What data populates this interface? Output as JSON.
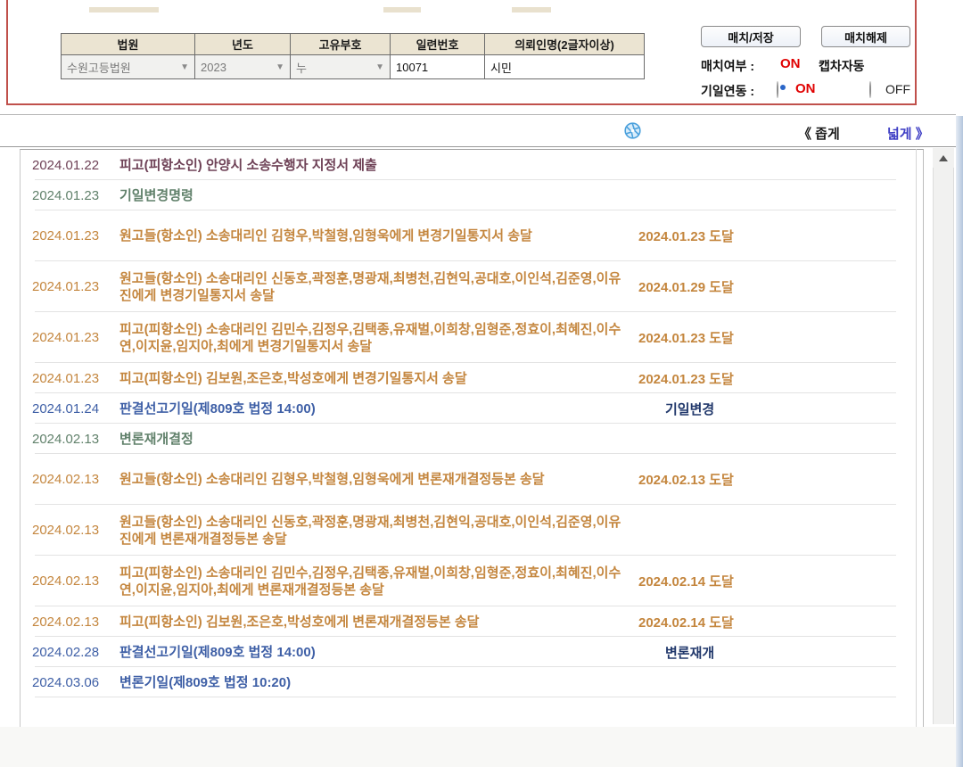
{
  "form": {
    "headers": {
      "court": "법원",
      "year": "년도",
      "code": "고유부호",
      "serial": "일련번호",
      "client": "의뢰인명(2글자이상)"
    },
    "values": {
      "court": "수원고등법원",
      "year": "2023",
      "code": "누",
      "serial": "10071",
      "client": "시민"
    }
  },
  "controls": {
    "match_save_button": "매치/저장",
    "match_clear_button": "매치해제",
    "match_status_label": "매치여부 :",
    "match_status_value": "ON",
    "captcha_auto_label": "캡차자동",
    "schedule_sync_label": "기일연동 :",
    "radio_on_label": "ON",
    "radio_off_label": "OFF"
  },
  "toolbar": {
    "narrow_label": "《 좁게",
    "wide_label": "넓게 》"
  },
  "colors": {
    "panel_border_red": "#c0504b",
    "status_red": "#e00000",
    "wide_link_blue": "#3c3cc4",
    "row_maroon": "#6e4156",
    "row_green": "#61816b",
    "row_orange": "#c4863e",
    "row_blue": "#3e5fa6",
    "status_navy": "#21386b",
    "header_beige": "#ebe4d2"
  },
  "table": {
    "rows": [
      {
        "date": "2024.01.22",
        "text": "피고(피항소인) 안양시 소송수행자 지정서 제출",
        "type": "maroon",
        "lines": 1,
        "right": "",
        "right_style": "none"
      },
      {
        "date": "2024.01.23",
        "text": "기일변경명령",
        "type": "green",
        "lines": 1,
        "right": "",
        "right_style": "none"
      },
      {
        "date": "2024.01.23",
        "text": "원고들(항소인) 소송대리인 김형우,박철형,임형욱에게 변경기일통지서 송달",
        "type": "orange",
        "lines": 2,
        "right": "2024.01.23 도달",
        "right_style": "delivery"
      },
      {
        "date": "2024.01.23",
        "text": "원고들(항소인) 소송대리인 신동호,곽정훈,명광재,최병천,김현익,공대호,이인석,김준영,이유진에게 변경기일통지서 송달",
        "type": "orange",
        "lines": 2,
        "right": "2024.01.29 도달",
        "right_style": "delivery"
      },
      {
        "date": "2024.01.23",
        "text": "피고(피항소인) 소송대리인 김민수,김정우,김택종,유재벌,이희창,임형준,정효이,최혜진,이수연,이지윤,임지아,최에게 변경기일통지서 송달",
        "type": "orange",
        "lines": 2,
        "right": "2024.01.23 도달",
        "right_style": "delivery"
      },
      {
        "date": "2024.01.23",
        "text": "피고(피항소인) 김보원,조은호,박성호에게 변경기일통지서 송달",
        "type": "orange",
        "lines": 1,
        "right": "2024.01.23 도달",
        "right_style": "delivery"
      },
      {
        "date": "2024.01.24",
        "text": "판결선고기일(제809호 법정 14:00)",
        "type": "blue",
        "lines": 1,
        "right": "기일변경",
        "right_style": "status"
      },
      {
        "date": "2024.02.13",
        "text": "변론재개결정",
        "type": "green",
        "lines": 1,
        "right": "",
        "right_style": "none"
      },
      {
        "date": "2024.02.13",
        "text": "원고들(항소인) 소송대리인 김형우,박철형,임형욱에게 변론재개결정등본 송달",
        "type": "orange",
        "lines": 2,
        "right": "2024.02.13 도달",
        "right_style": "delivery"
      },
      {
        "date": "2024.02.13",
        "text": "원고들(항소인) 소송대리인 신동호,곽정훈,명광재,최병천,김현익,공대호,이인석,김준영,이유진에게 변론재개결정등본 송달",
        "type": "orange",
        "lines": 2,
        "right": "",
        "right_style": "none"
      },
      {
        "date": "2024.02.13",
        "text": "피고(피항소인) 소송대리인 김민수,김정우,김택종,유재벌,이희창,임형준,정효이,최혜진,이수연,이지윤,임지아,최에게 변론재개결정등본 송달",
        "type": "orange",
        "lines": 2,
        "right": "2024.02.14 도달",
        "right_style": "delivery"
      },
      {
        "date": "2024.02.13",
        "text": "피고(피항소인) 김보원,조은호,박성호에게 변론재개결정등본 송달",
        "type": "orange",
        "lines": 1,
        "right": "2024.02.14 도달",
        "right_style": "delivery"
      },
      {
        "date": "2024.02.28",
        "text": "판결선고기일(제809호 법정 14:00)",
        "type": "blue",
        "lines": 1,
        "right": "변론재개",
        "right_style": "status"
      },
      {
        "date": "2024.03.06",
        "text": "변론기일(제809호 법정 10:20)",
        "type": "blue",
        "lines": 1,
        "right": "",
        "right_style": "none"
      }
    ]
  }
}
